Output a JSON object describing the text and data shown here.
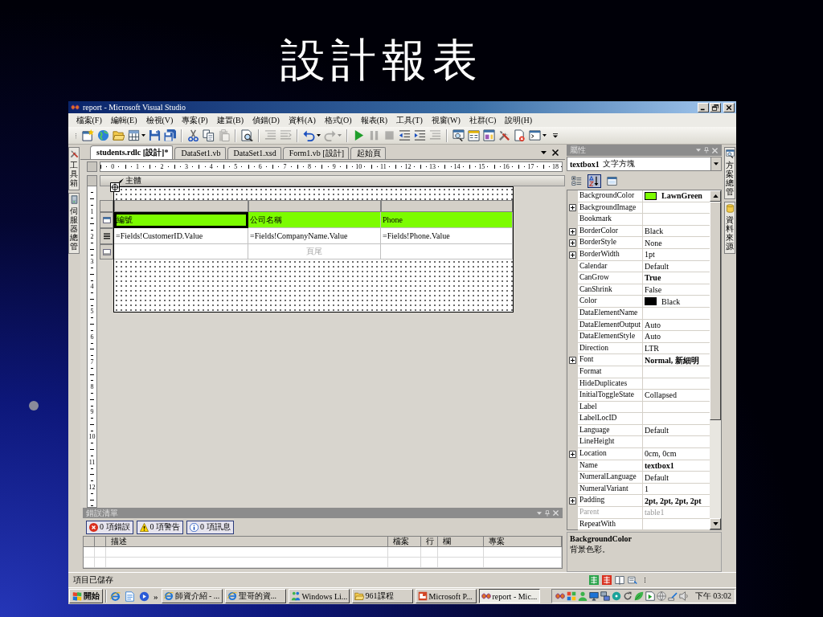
{
  "slide": {
    "title": "設計報表"
  },
  "window": {
    "title": "report - Microsoft Visual Studio"
  },
  "menu": [
    "檔案(F)",
    "編輯(E)",
    "檢視(V)",
    "專案(P)",
    "建置(B)",
    "偵錯(D)",
    "資料(A)",
    "格式(O)",
    "報表(R)",
    "工具(T)",
    "視窗(W)",
    "社群(C)",
    "說明(H)"
  ],
  "toolbar": [
    [
      {
        "kind": "project",
        "disabled": false
      },
      {
        "kind": "web",
        "disabled": false
      },
      {
        "kind": "open",
        "disabled": false
      },
      {
        "kind": "additem",
        "disabled": false
      },
      {
        "kind": "dropdown",
        "disabled": false
      },
      {
        "kind": "save",
        "disabled": false
      },
      {
        "kind": "saveall",
        "disabled": false
      }
    ],
    [
      {
        "kind": "cut",
        "disabled": false
      },
      {
        "kind": "copy",
        "disabled": false
      },
      {
        "kind": "paste",
        "disabled": true
      }
    ],
    [
      {
        "kind": "find",
        "disabled": false
      }
    ],
    [
      {
        "kind": "comment",
        "disabled": true
      },
      {
        "kind": "uncomment",
        "disabled": true
      }
    ],
    [
      {
        "kind": "undo",
        "disabled": false
      },
      {
        "kind": "dropdown",
        "disabled": false
      },
      {
        "kind": "redo",
        "disabled": true
      },
      {
        "kind": "dropdown",
        "disabled": true
      }
    ],
    [
      {
        "kind": "start",
        "disabled": false
      },
      {
        "kind": "pause",
        "disabled": true
      },
      {
        "kind": "stop",
        "disabled": true
      },
      {
        "kind": "outdent",
        "disabled": false
      },
      {
        "kind": "indent",
        "disabled": false
      },
      {
        "kind": "comment",
        "disabled": true
      }
    ],
    [
      {
        "kind": "solution",
        "disabled": false
      },
      {
        "kind": "properties",
        "disabled": false
      },
      {
        "kind": "browser",
        "disabled": false
      },
      {
        "kind": "tools",
        "disabled": false
      },
      {
        "kind": "remove",
        "disabled": false
      },
      {
        "kind": "command",
        "disabled": false
      },
      {
        "kind": "dropdown",
        "disabled": false
      }
    ]
  ],
  "left_dock": [
    {
      "label": "工具箱",
      "kind": "tools"
    },
    {
      "label": "伺服器總管",
      "kind": "server"
    }
  ],
  "document_tabs": [
    {
      "label": "students.rdlc [設計]*",
      "selected": true
    },
    {
      "label": "DataSet1.vb",
      "selected": false
    },
    {
      "label": "DataSet1.xsd",
      "selected": false
    },
    {
      "label": "Form1.vb [設計]",
      "selected": false
    },
    {
      "label": "起始頁",
      "selected": false
    }
  ],
  "designer": {
    "h_ruler": [
      "0",
      "1",
      "2",
      "3",
      "4",
      "5",
      "6",
      "7",
      "8",
      "9",
      "10",
      "11",
      "12",
      "13",
      "14",
      "15",
      "16",
      "17",
      "18"
    ],
    "v_ruler": [
      "1",
      "2",
      "3",
      "4",
      "5",
      "6",
      "7",
      "8",
      "9",
      "10",
      "11",
      "12"
    ],
    "band": "主體",
    "table": {
      "columns": [
        {
          "header": "編號",
          "field": "=Fields!CustomerID.Value",
          "selected": true
        },
        {
          "header": "公司名稱",
          "field": "=Fields!CompanyName.Value",
          "footer": "頁尾",
          "selected": false
        },
        {
          "header": "Phone",
          "field": "=Fields!Phone.Value",
          "selected": false
        }
      ]
    }
  },
  "error_list": {
    "title": "錯誤清單",
    "filters": [
      {
        "kind": "error",
        "label": "0 項錯誤",
        "selected": true
      },
      {
        "kind": "warning",
        "label": "0 項警告",
        "selected": true
      },
      {
        "kind": "info",
        "label": "0 項訊息",
        "selected": true
      }
    ],
    "columns": [
      "描述",
      "檔案",
      "行",
      "欄",
      "專案"
    ]
  },
  "properties": {
    "title": "屬性",
    "object": {
      "name": "textbox1",
      "type": "文字方塊"
    },
    "tools": [
      {
        "kind": "categorized",
        "selected": false
      },
      {
        "kind": "alphabetical",
        "selected": true
      },
      {
        "kind": "pages",
        "selected": false
      }
    ],
    "rows": [
      {
        "name": "BackgroundColor",
        "value": "LawnGreen",
        "color": "#7cfc00",
        "expandable": false,
        "modified": true,
        "disabled": false
      },
      {
        "name": "BackgroundImage",
        "expandable": true,
        "disabled": false
      },
      {
        "name": "Bookmark",
        "expandable": false,
        "disabled": false
      },
      {
        "name": "BorderColor",
        "value": "Black",
        "expandable": true,
        "modified": false,
        "disabled": false
      },
      {
        "name": "BorderStyle",
        "value": "None",
        "expandable": true,
        "modified": false,
        "disabled": false
      },
      {
        "name": "BorderWidth",
        "value": "1pt",
        "expandable": true,
        "modified": false,
        "disabled": false
      },
      {
        "name": "Calendar",
        "value": "Default",
        "expandable": false,
        "modified": false,
        "disabled": false
      },
      {
        "name": "CanGrow",
        "value": "True",
        "expandable": false,
        "modified": true,
        "disabled": false
      },
      {
        "name": "CanShrink",
        "value": "False",
        "expandable": false,
        "modified": false,
        "disabled": false
      },
      {
        "name": "Color",
        "value": "Black",
        "color": "#000000",
        "expandable": false,
        "modified": false,
        "disabled": false
      },
      {
        "name": "DataElementName",
        "expandable": false,
        "disabled": false
      },
      {
        "name": "DataElementOutput",
        "value": "Auto",
        "expandable": false,
        "modified": false,
        "disabled": false
      },
      {
        "name": "DataElementStyle",
        "value": "Auto",
        "expandable": false,
        "modified": false,
        "disabled": false
      },
      {
        "name": "Direction",
        "value": "LTR",
        "expandable": false,
        "modified": false,
        "disabled": false
      },
      {
        "name": "Font",
        "value": "Normal, 新細明",
        "expandable": true,
        "modified": true,
        "disabled": false
      },
      {
        "name": "Format",
        "expandable": false,
        "disabled": false
      },
      {
        "name": "HideDuplicates",
        "expandable": false,
        "disabled": false
      },
      {
        "name": "InitialToggleState",
        "value": "Collapsed",
        "expandable": false,
        "modified": false,
        "disabled": false
      },
      {
        "name": "Label",
        "expandable": false,
        "disabled": false
      },
      {
        "name": "LabelLocID",
        "expandable": false,
        "disabled": false
      },
      {
        "name": "Language",
        "value": "Default",
        "expandable": false,
        "modified": false,
        "disabled": false
      },
      {
        "name": "LineHeight",
        "expandable": false,
        "disabled": false
      },
      {
        "name": "Location",
        "value": "0cm, 0cm",
        "expandable": true,
        "modified": false,
        "disabled": false
      },
      {
        "name": "Name",
        "value": "textbox1",
        "expandable": false,
        "modified": true,
        "disabled": false
      },
      {
        "name": "NumeralLanguage",
        "value": "Default",
        "expandable": false,
        "modified": false,
        "disabled": false
      },
      {
        "name": "NumeralVariant",
        "value": "1",
        "expandable": false,
        "modified": false,
        "disabled": false
      },
      {
        "name": "Padding",
        "value": "2pt, 2pt, 2pt, 2pt",
        "expandable": true,
        "modified": true,
        "disabled": false
      },
      {
        "name": "Parent",
        "value": "table1",
        "expandable": false,
        "modified": false,
        "disabled": true
      },
      {
        "name": "RepeatWith",
        "expandable": false,
        "disabled": false
      }
    ],
    "description": {
      "title": "BackgroundColor",
      "text": "背景色彩。"
    }
  },
  "right_dock": [
    {
      "label": "方案總管",
      "kind": "solution"
    },
    {
      "label": "資料來源",
      "kind": "database"
    }
  ],
  "status_bar": {
    "text": "項目已儲存"
  },
  "taskbar": {
    "start": "開始",
    "overflow": "»",
    "tasks": [
      {
        "label": "師資介紹 - ...",
        "kind": "ie",
        "selected": false
      },
      {
        "label": "聖哥的資...",
        "kind": "ie",
        "selected": false
      },
      {
        "label": "Windows Li...",
        "kind": "messenger",
        "selected": false
      },
      {
        "label": "961課程",
        "kind": "open",
        "selected": false
      },
      {
        "label": "Microsoft P...",
        "kind": "powerpoint",
        "selected": false
      },
      {
        "label": "report - Mic...",
        "kind": "vs",
        "selected": true
      }
    ],
    "clock": "下午 03:02"
  }
}
